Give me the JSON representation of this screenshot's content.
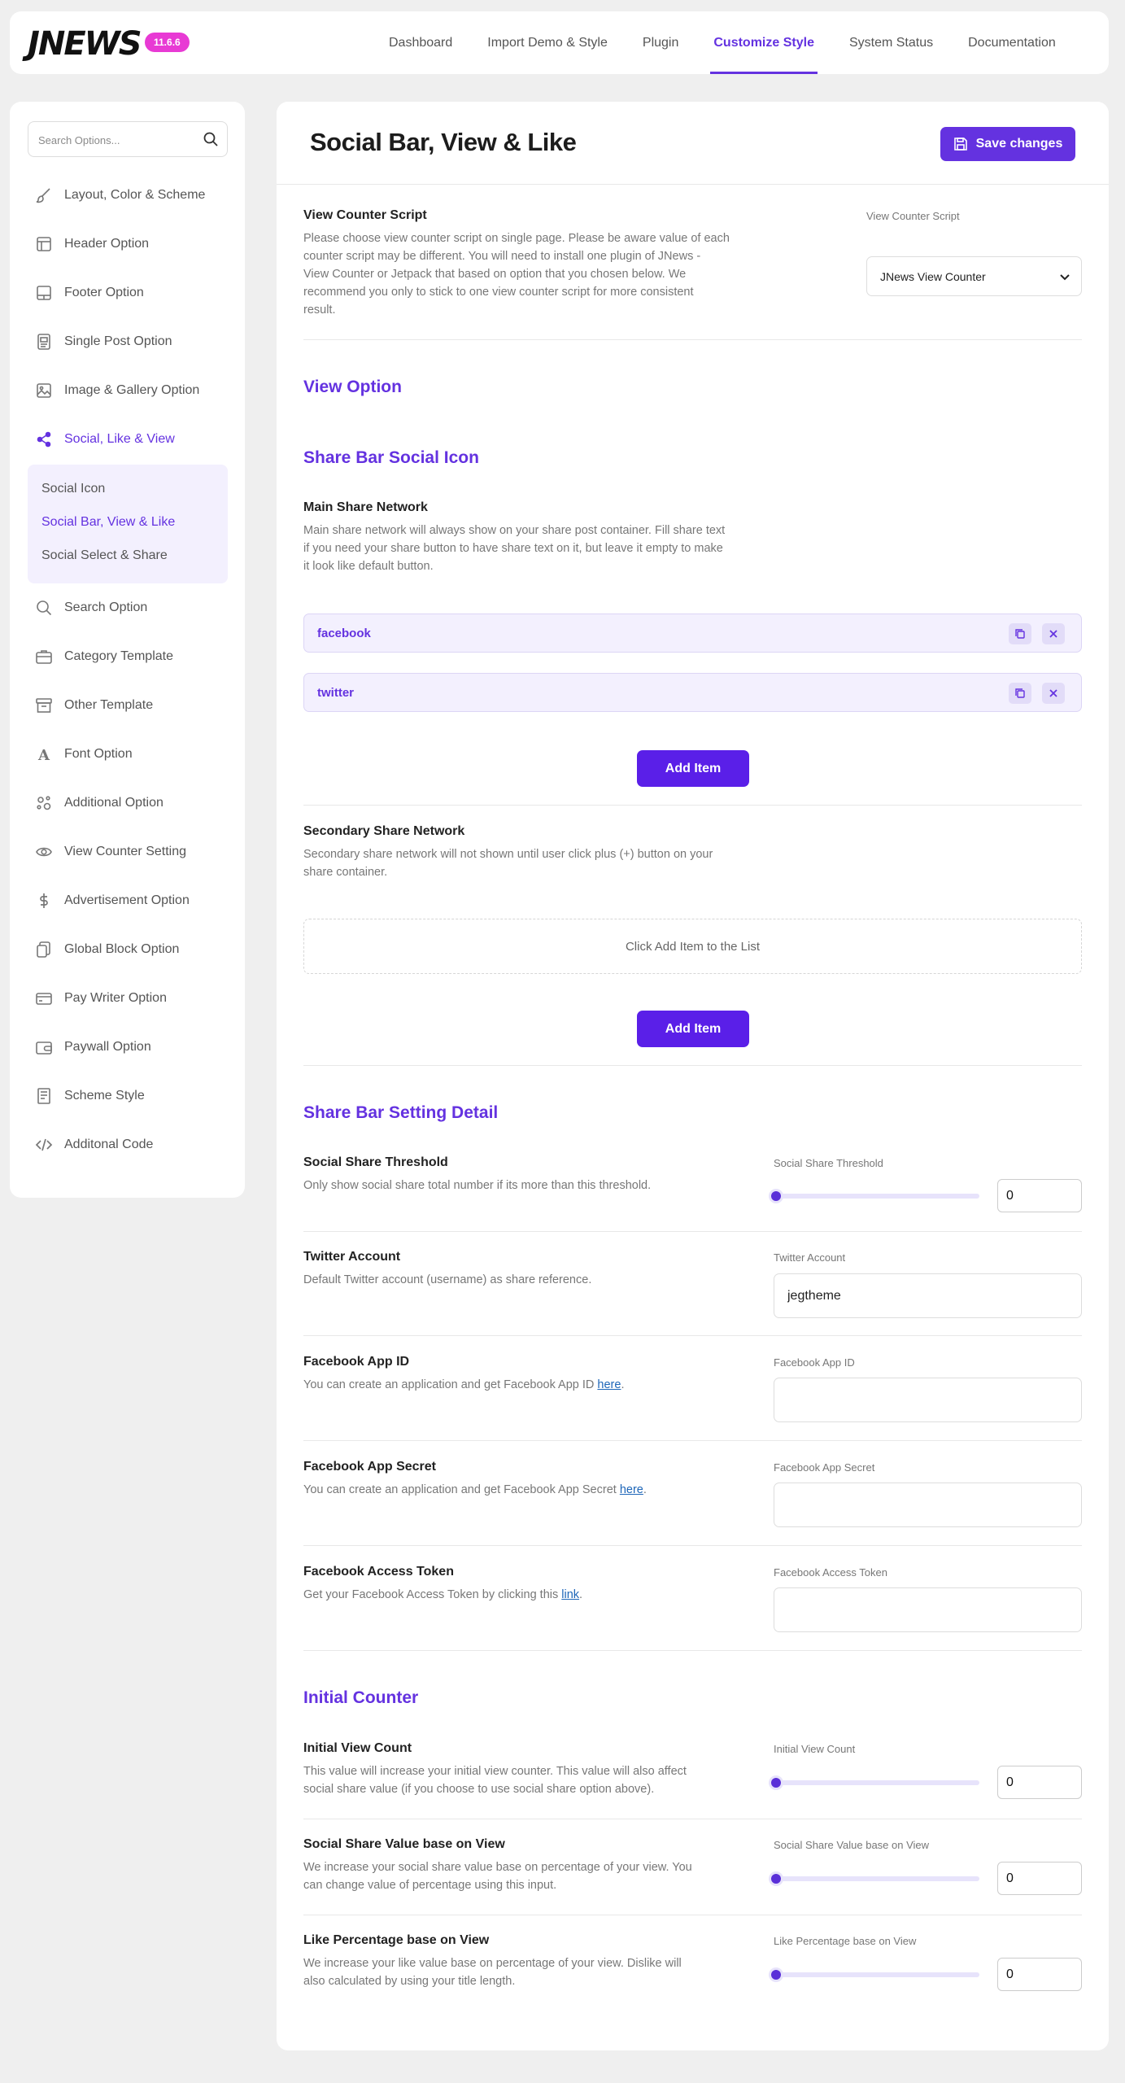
{
  "header": {
    "logo": "JNEWS",
    "version": "11.6.6",
    "nav": [
      {
        "label": "Dashboard"
      },
      {
        "label": "Import Demo & Style"
      },
      {
        "label": "Plugin"
      },
      {
        "label": "Customize Style",
        "active": true
      },
      {
        "label": "System Status"
      },
      {
        "label": "Documentation"
      }
    ]
  },
  "sidebar": {
    "search_placeholder": "Search Options...",
    "items": [
      {
        "label": "Layout, Color & Scheme",
        "icon": "brush-icon"
      },
      {
        "label": "Header Option",
        "icon": "layout-header-icon"
      },
      {
        "label": "Footer Option",
        "icon": "layout-footer-icon"
      },
      {
        "label": "Single Post Option",
        "icon": "post-icon"
      },
      {
        "label": "Image & Gallery Option",
        "icon": "image-icon"
      },
      {
        "label": "Social, Like & View",
        "icon": "share-icon",
        "active": true
      },
      {
        "label": "Search Option",
        "icon": "search-icon"
      },
      {
        "label": "Category Template",
        "icon": "briefcase-icon"
      },
      {
        "label": "Other Template",
        "icon": "archive-icon"
      },
      {
        "label": "Font Option",
        "icon": "font-icon"
      },
      {
        "label": "Additional Option",
        "icon": "gears-icon"
      },
      {
        "label": "View Counter Setting",
        "icon": "eye-icon"
      },
      {
        "label": "Advertisement Option",
        "icon": "dollar-icon"
      },
      {
        "label": "Global Block Option",
        "icon": "blocks-icon"
      },
      {
        "label": "Pay Writer Option",
        "icon": "card-icon"
      },
      {
        "label": "Paywall Option",
        "icon": "wallet-icon"
      },
      {
        "label": "Scheme Style",
        "icon": "document-icon"
      },
      {
        "label": "Additonal Code",
        "icon": "code-icon"
      }
    ],
    "submenu": [
      {
        "label": "Social Icon"
      },
      {
        "label": "Social Bar, View & Like",
        "active": true
      },
      {
        "label": "Social Select & Share"
      }
    ]
  },
  "main": {
    "title": "Social Bar, View & Like",
    "save_label": "Save changes",
    "view_counter": {
      "title": "View Counter Script",
      "desc_lines": [
        "Please choose view counter script on single page. Please be aware value of each",
        "counter script may be different. You will need to install one plugin of JNews -",
        "View Counter or Jetpack that based on option that you chosen below. We",
        "recommend you only to stick to one view counter script for more consistent",
        "result."
      ],
      "field_label": "View Counter Script",
      "selected": "JNews View Counter"
    },
    "view_option_heading": "View Option",
    "share_bar_heading": "Share Bar Social Icon",
    "main_share": {
      "title": "Main Share Network",
      "desc_lines": [
        "Main share network will always show on your share post container. Fill share text",
        "if you need your share button to have share text on it, but leave it empty to make",
        "it look like default button."
      ],
      "items": [
        {
          "label": "facebook"
        },
        {
          "label": "twitter"
        }
      ],
      "add_label": "Add Item"
    },
    "secondary_share": {
      "title": "Secondary Share Network",
      "desc_lines": [
        "Secondary share network will not shown until user click plus (+) button on your",
        "share container."
      ],
      "empty_text": "Click Add Item to the List",
      "add_label": "Add Item"
    },
    "share_detail_heading": "Share Bar Setting Detail",
    "threshold": {
      "title": "Social Share Threshold",
      "desc": "Only show social share total number if its more than this threshold.",
      "field_label": "Social Share Threshold",
      "value": "0"
    },
    "twitter": {
      "title": "Twitter Account",
      "desc": "Default Twitter account (username) as share reference.",
      "field_label": "Twitter Account",
      "value": "jegtheme"
    },
    "fb_app_id": {
      "title": "Facebook App ID",
      "desc": "You can create an application and get Facebook App ID ",
      "link": "here",
      "field_label": "Facebook App ID",
      "value": ""
    },
    "fb_app_secret": {
      "title": "Facebook App Secret",
      "desc": "You can create an application and get Facebook App Secret ",
      "link": "here",
      "field_label": "Facebook App Secret",
      "value": ""
    },
    "fb_token": {
      "title": "Facebook Access Token",
      "desc": "Get your Facebook Access Token by clicking this ",
      "link": "link",
      "field_label": "Facebook Access Token",
      "value": ""
    },
    "initial_counter_heading": "Initial Counter",
    "initial_view": {
      "title": "Initial View Count",
      "desc_lines": [
        "This value will increase your initial view counter. This value will also affect",
        "social share value (if you choose to use social share option above)."
      ],
      "field_label": "Initial View Count",
      "value": "0"
    },
    "share_value": {
      "title": "Social Share Value base on View",
      "desc_lines": [
        "We increase your social share value base on percentage of your view. You",
        "can change value of percentage using this input."
      ],
      "field_label": "Social Share Value base on View",
      "value": "0"
    },
    "like_pct": {
      "title": "Like Percentage base on View",
      "desc_lines": [
        "We increase your like value base on percentage of your view. Dislike will",
        "also calculated by using your title length."
      ],
      "field_label": "Like Percentage base on View",
      "value": "0"
    }
  }
}
